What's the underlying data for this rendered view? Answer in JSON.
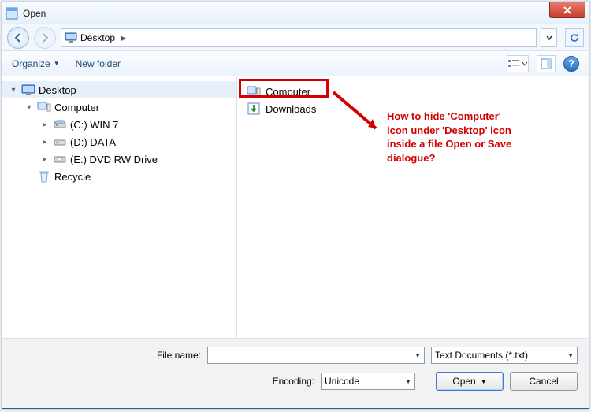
{
  "window": {
    "title": "Open"
  },
  "nav": {
    "crumb": "Desktop"
  },
  "toolbar": {
    "organize": "Organize",
    "newfolder": "New folder"
  },
  "tree": {
    "desktop": "Desktop",
    "computer": "Computer",
    "c_drive": "(C:) WIN 7",
    "d_drive": "(D:) DATA",
    "e_drive": "(E:) DVD RW Drive",
    "recycle": "Recycle"
  },
  "list": {
    "computer": "Computer",
    "downloads": "Downloads"
  },
  "annotation": {
    "text": "How to hide 'Computer' icon under 'Desktop' icon inside a file Open or Save dialogue?"
  },
  "footer": {
    "filename_label": "File name:",
    "encoding_label": "Encoding:",
    "encoding_value": "Unicode",
    "filter_value": "Text Documents (*.txt)",
    "open": "Open",
    "cancel": "Cancel"
  }
}
